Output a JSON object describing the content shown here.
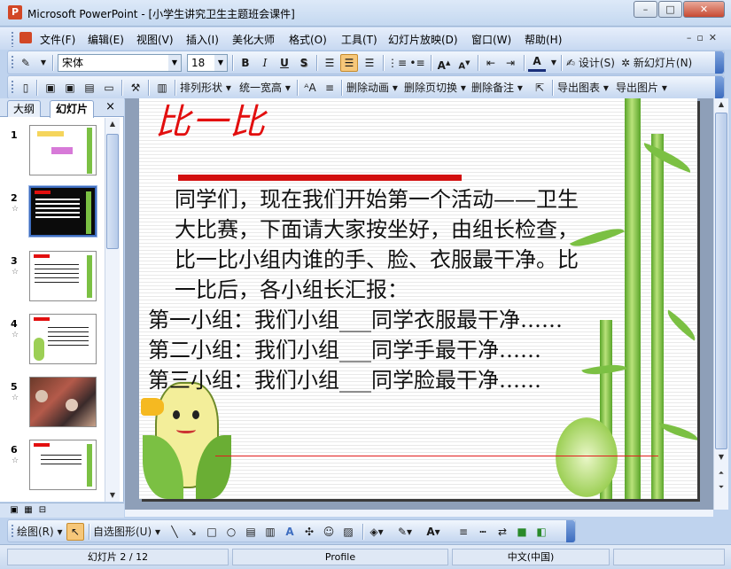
{
  "window": {
    "title": "Microsoft PowerPoint - [小学生讲究卫生主题班会课件]",
    "app_icon": "powerpoint-icon",
    "minimize_icon": "minimize-icon",
    "maximize_icon": "maximize-icon",
    "close_icon": "close-icon"
  },
  "menu": {
    "items": [
      "文件(F)",
      "编辑(E)",
      "视图(V)",
      "插入(I)",
      "美化大师",
      "格式(O)",
      "工具(T)",
      "幻灯片放映(D)",
      "窗口(W)",
      "帮助(H)"
    ]
  },
  "formatting_toolbar": {
    "font_name": "宋体",
    "font_size": "18",
    "bold": "B",
    "italic": "I",
    "underline": "U",
    "shadow": "S",
    "design_label": "设计(S)",
    "new_slide_label": "新幻灯片(N)"
  },
  "extra_toolbar": {
    "arrange_label": "排列形状",
    "same_width_label": "统一宽高",
    "delete_animation_label": "删除动画",
    "delete_transition_label": "删除页切换",
    "delete_notes_label": "删除备注",
    "export_image_label": "导出图片",
    "export_chart_label": "导出图表"
  },
  "panel": {
    "tab_outline": "大纲",
    "tab_slides": "幻灯片",
    "close": "×",
    "slides": [
      {
        "number": "1",
        "star": ""
      },
      {
        "number": "2",
        "star": "☆"
      },
      {
        "number": "3",
        "star": "☆"
      },
      {
        "number": "4",
        "star": "☆"
      },
      {
        "number": "5",
        "star": "☆"
      },
      {
        "number": "6",
        "star": "☆"
      }
    ]
  },
  "slide": {
    "title": "比一比",
    "paragraph_lines": [
      "同学们，现在我们开始第一个活动——卫生",
      "大比赛，下面请大家按坐好，由组长检查，",
      "比一比小组内谁的手、脸、衣服最干净。比",
      "一比后，各小组长汇报："
    ],
    "group_lines": [
      "第一小组：我们小组___同学衣服最干净……",
      "第二小组：我们小组___同学手最干净……",
      "第三小组：我们小组___同学脸最干净……"
    ]
  },
  "drawing_toolbar": {
    "draw_label": "绘图(R)",
    "autoshapes_label": "自选图形(U)"
  },
  "statusbar": {
    "slide_position": "幻灯片 2 / 12",
    "theme": "Profile",
    "language": "中文(中国)"
  },
  "colors": {
    "title_red": "#e20f0f",
    "accent_blue": "#3f6ec0",
    "bamboo_green": "#7bc043"
  }
}
